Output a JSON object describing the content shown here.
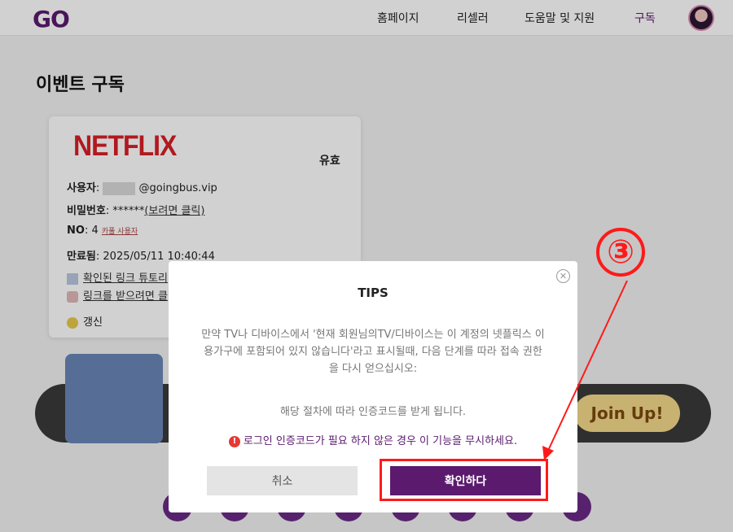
{
  "header": {
    "logo": "GO",
    "nav": [
      "홈페이지",
      "리셀러",
      "도움말 및 지원",
      "구독"
    ]
  },
  "page": {
    "title": "이벤트 구독"
  },
  "card": {
    "brand": "NETFLIX",
    "status": "유효",
    "user_label": "사용자",
    "user_value": "@goingbus.vip",
    "password_label": "비밀번호",
    "password_value": "******",
    "password_link": "(보려면 클릭)",
    "no_label": "NO",
    "no_value": "4",
    "no_link": "카풀 사용자",
    "expiry_label": "만료됨",
    "expiry_value": "2025/05/11 10:40:44",
    "tutorial_link": "확인된 링크 튜토리",
    "get_link": "링크를 받으려면 클",
    "renew": "갱신"
  },
  "banner": {
    "join": "Join Up!"
  },
  "modal": {
    "title": "TIPS",
    "body": "만약 TV나 디바이스에서 '현재 회원님의TV/디바이스는 이 계정의 넷플릭스 이용가구에 포함되어 있지 않습니다'라고 표시될때, 다음 단계를 따라 접속 권한을 다시 얻으십시오:",
    "note": "해당 절차에 따라 인증코드를 받게 됩니다.",
    "warning": "로그인 인증코드가 필요 하지 않은 경우 이 기능을 무시하세요.",
    "cancel": "취소",
    "confirm": "확인하다"
  },
  "annotation": {
    "step": "③",
    "color": "#ff1a1a"
  },
  "colors": {
    "brand": "#5b1a6e",
    "netflix": "#d81f26"
  }
}
